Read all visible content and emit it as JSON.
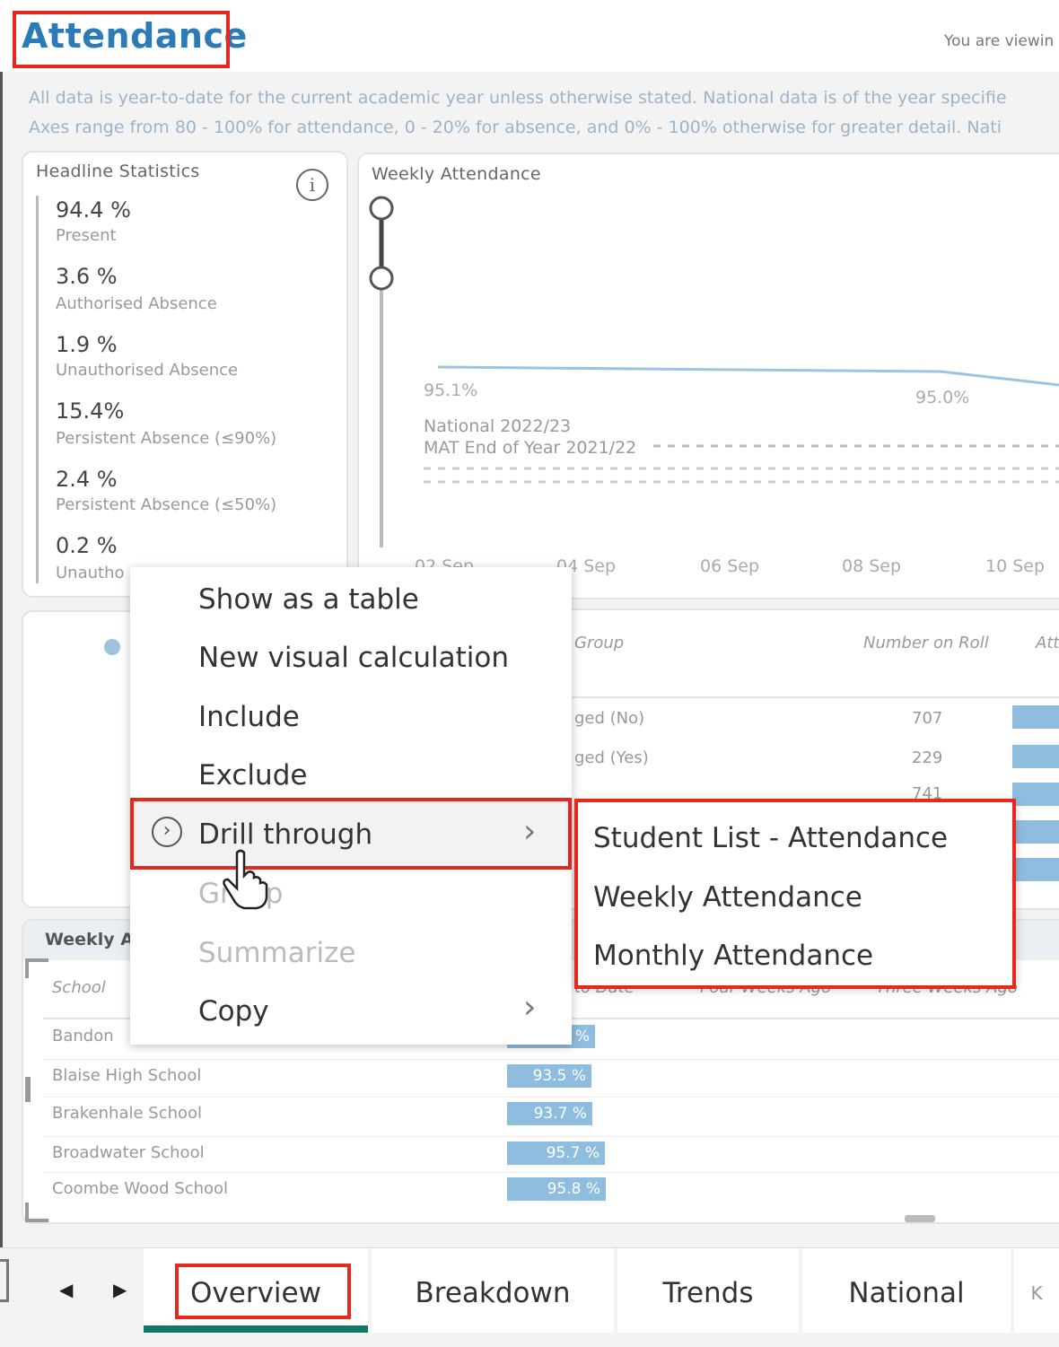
{
  "header": {
    "title": "Attendance",
    "viewing_text": "You are viewin"
  },
  "info": {
    "line1": "All data is year-to-date for the current academic year unless otherwise stated. National data is of the year specifie",
    "line2": "Axes range from 80 - 100% for attendance, 0 - 20% for absence, and 0% - 100% otherwise for greater detail. Nati"
  },
  "headline": {
    "title": "Headline Statistics",
    "stats": [
      {
        "value": "94.4 %",
        "label": "Present"
      },
      {
        "value": "3.6 %",
        "label": "Authorised Absence"
      },
      {
        "value": "1.9 %",
        "label": "Unauthorised Absence"
      },
      {
        "value": "15.4%",
        "label": "Persistent Absence (≤90%)"
      },
      {
        "value": "2.4 %",
        "label": "Persistent Absence (≤50%)"
      },
      {
        "value": "0.2 %",
        "label": "Unautho"
      }
    ]
  },
  "weekly_chart": {
    "title": "Weekly Attendance",
    "label_left": "95.1%",
    "label_right": "95.0%",
    "national_label": "National 2022/23",
    "mat_label": "MAT End of Year 2021/22",
    "x_ticks": [
      "02 Sep",
      "04 Sep",
      "06 Sep",
      "08 Sep",
      "10 Sep"
    ]
  },
  "chart_data": {
    "type": "line",
    "title": "Weekly Attendance",
    "series": [
      {
        "values": [
          95.1,
          95.0
        ]
      }
    ],
    "x": [
      "02 Sep",
      "04 Sep",
      "06 Sep",
      "08 Sep",
      "10 Sep"
    ],
    "data_labels": [
      "95.1%",
      "95.0%"
    ],
    "reference_lines": [
      "National 2022/23",
      "MAT End of Year 2021/22"
    ]
  },
  "group_table": {
    "col_group": "Group",
    "col_roll": "Number on Roll",
    "col_att": "Att",
    "rows": [
      {
        "group": "ged (No)",
        "roll": "707"
      },
      {
        "group": "ged (Yes)",
        "roll": "229"
      },
      {
        "group": "",
        "roll": "741"
      }
    ]
  },
  "weekly_table": {
    "title": "Weekly A",
    "col_school": "School",
    "col_date": "to Date",
    "col_four": "Four Weeks Ago",
    "col_three": "Three Weeks Ago",
    "rows": [
      {
        "school": "Bandon",
        "value": "94.2 %",
        "fill": 0.942
      },
      {
        "school": "Blaise High School",
        "value": "93.5 %",
        "fill": 0.935
      },
      {
        "school": "Brakenhale School",
        "value": "93.7 %",
        "fill": 0.937
      },
      {
        "school": "Broadwater School",
        "value": "95.7 %",
        "fill": 0.957
      },
      {
        "school": "Coombe Wood School",
        "value": "95.8 %",
        "fill": 0.958
      }
    ]
  },
  "context_menu": {
    "items": {
      "show_table": "Show as a table",
      "new_visual": "New visual calculation",
      "include": "Include",
      "exclude": "Exclude",
      "drill": "Drill through",
      "group": "Group",
      "summarize": "Summarize",
      "copy": "Copy"
    }
  },
  "submenu": {
    "items": [
      "Student List - Attendance",
      "Weekly Attendance",
      "Monthly Attendance"
    ]
  },
  "tabs": {
    "overview": "Overview",
    "breakdown": "Breakdown",
    "trends": "Trends",
    "national": "National",
    "more": "K"
  },
  "colors": {
    "accent": "#2b7bb9",
    "highlight": "#e8281e",
    "bar": "#8fbde0",
    "tab_active": "#117865"
  }
}
